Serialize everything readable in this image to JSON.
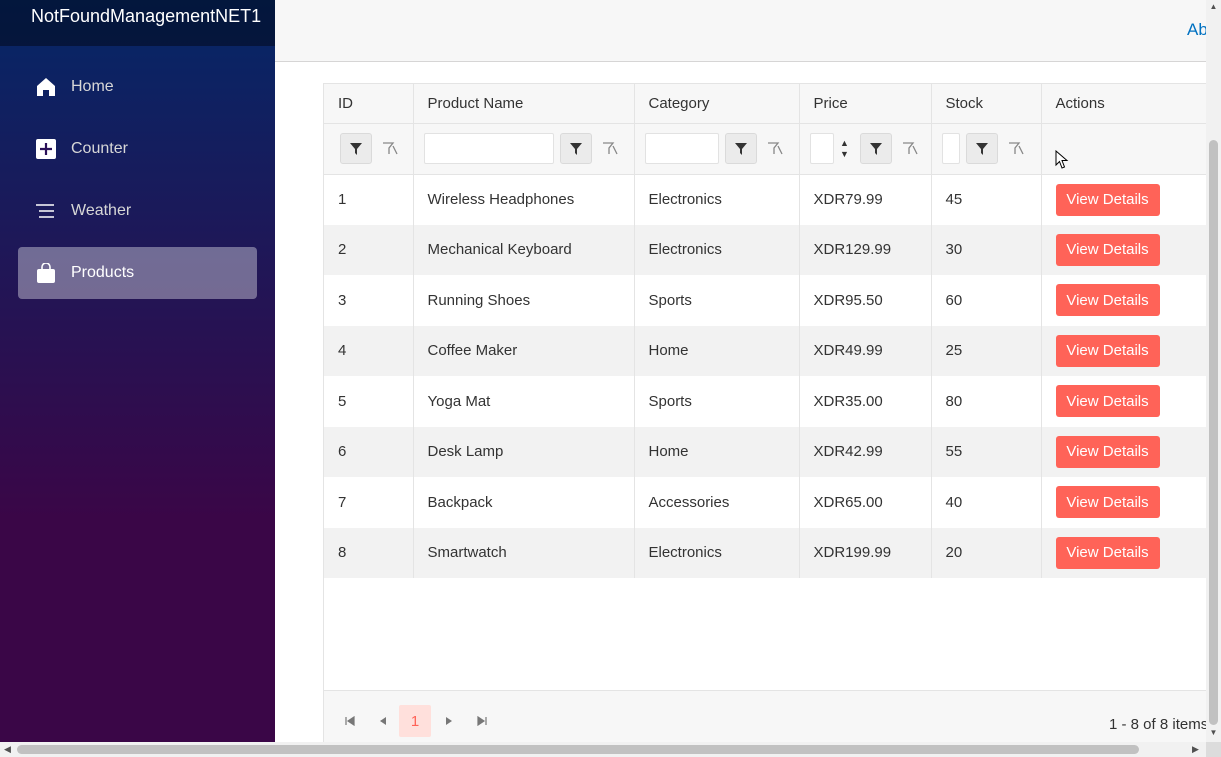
{
  "app": {
    "brand": "NotFoundManagementNET1",
    "about_link": "Ab"
  },
  "sidebar": {
    "items": [
      {
        "label": "Home",
        "icon": "home-icon",
        "active": false
      },
      {
        "label": "Counter",
        "icon": "plus-square-icon",
        "active": false
      },
      {
        "label": "Weather",
        "icon": "list-icon",
        "active": false
      },
      {
        "label": "Products",
        "icon": "shopping-bag-icon",
        "active": true
      }
    ]
  },
  "grid": {
    "columns": [
      "ID",
      "Product Name",
      "Category",
      "Price",
      "Stock",
      "Actions"
    ],
    "action_label": "View Details",
    "rows": [
      {
        "id": "1",
        "name": "Wireless Headphones",
        "category": "Electronics",
        "price": "XDR79.99",
        "stock": "45"
      },
      {
        "id": "2",
        "name": "Mechanical Keyboard",
        "category": "Electronics",
        "price": "XDR129.99",
        "stock": "30"
      },
      {
        "id": "3",
        "name": "Running Shoes",
        "category": "Sports",
        "price": "XDR95.50",
        "stock": "60"
      },
      {
        "id": "4",
        "name": "Coffee Maker",
        "category": "Home",
        "price": "XDR49.99",
        "stock": "25"
      },
      {
        "id": "5",
        "name": "Yoga Mat",
        "category": "Sports",
        "price": "XDR35.00",
        "stock": "80"
      },
      {
        "id": "6",
        "name": "Desk Lamp",
        "category": "Home",
        "price": "XDR42.99",
        "stock": "55"
      },
      {
        "id": "7",
        "name": "Backpack",
        "category": "Accessories",
        "price": "XDR65.00",
        "stock": "40"
      },
      {
        "id": "8",
        "name": "Smartwatch",
        "category": "Electronics",
        "price": "XDR199.99",
        "stock": "20"
      }
    ]
  },
  "pager": {
    "current_page": "1",
    "info": "1 - 8 of 8 items"
  },
  "colors": {
    "accent": "#ff6358",
    "sidebar_top": "#052767",
    "sidebar_bottom": "#3a0647",
    "link": "#0071c1"
  }
}
